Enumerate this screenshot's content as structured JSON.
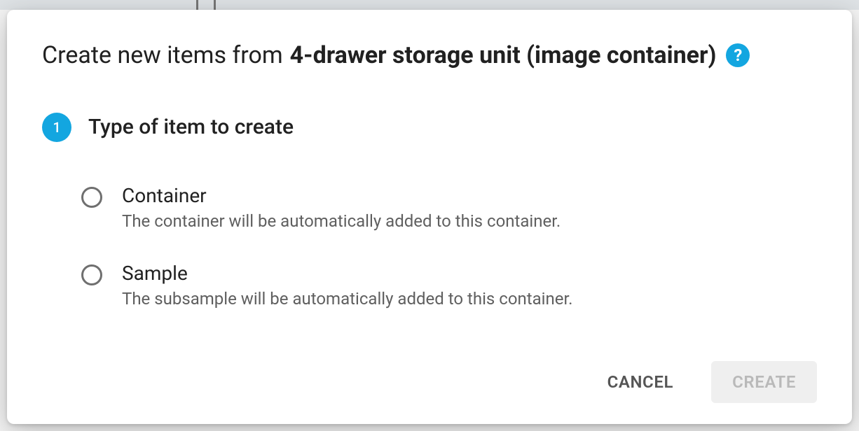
{
  "dialog": {
    "title_prefix": "Create new items from",
    "title_subject": "4-drawer storage unit (image container)",
    "help_glyph": "?"
  },
  "step": {
    "number": "1",
    "label": "Type of item to create"
  },
  "options": {
    "container": {
      "title": "Container",
      "description": "The container will be automatically added to this container."
    },
    "sample": {
      "title": "Sample",
      "description": "The subsample will be automatically added to this container."
    }
  },
  "buttons": {
    "cancel": "CANCEL",
    "create": "CREATE"
  },
  "colors": {
    "accent": "#13a6e0"
  }
}
